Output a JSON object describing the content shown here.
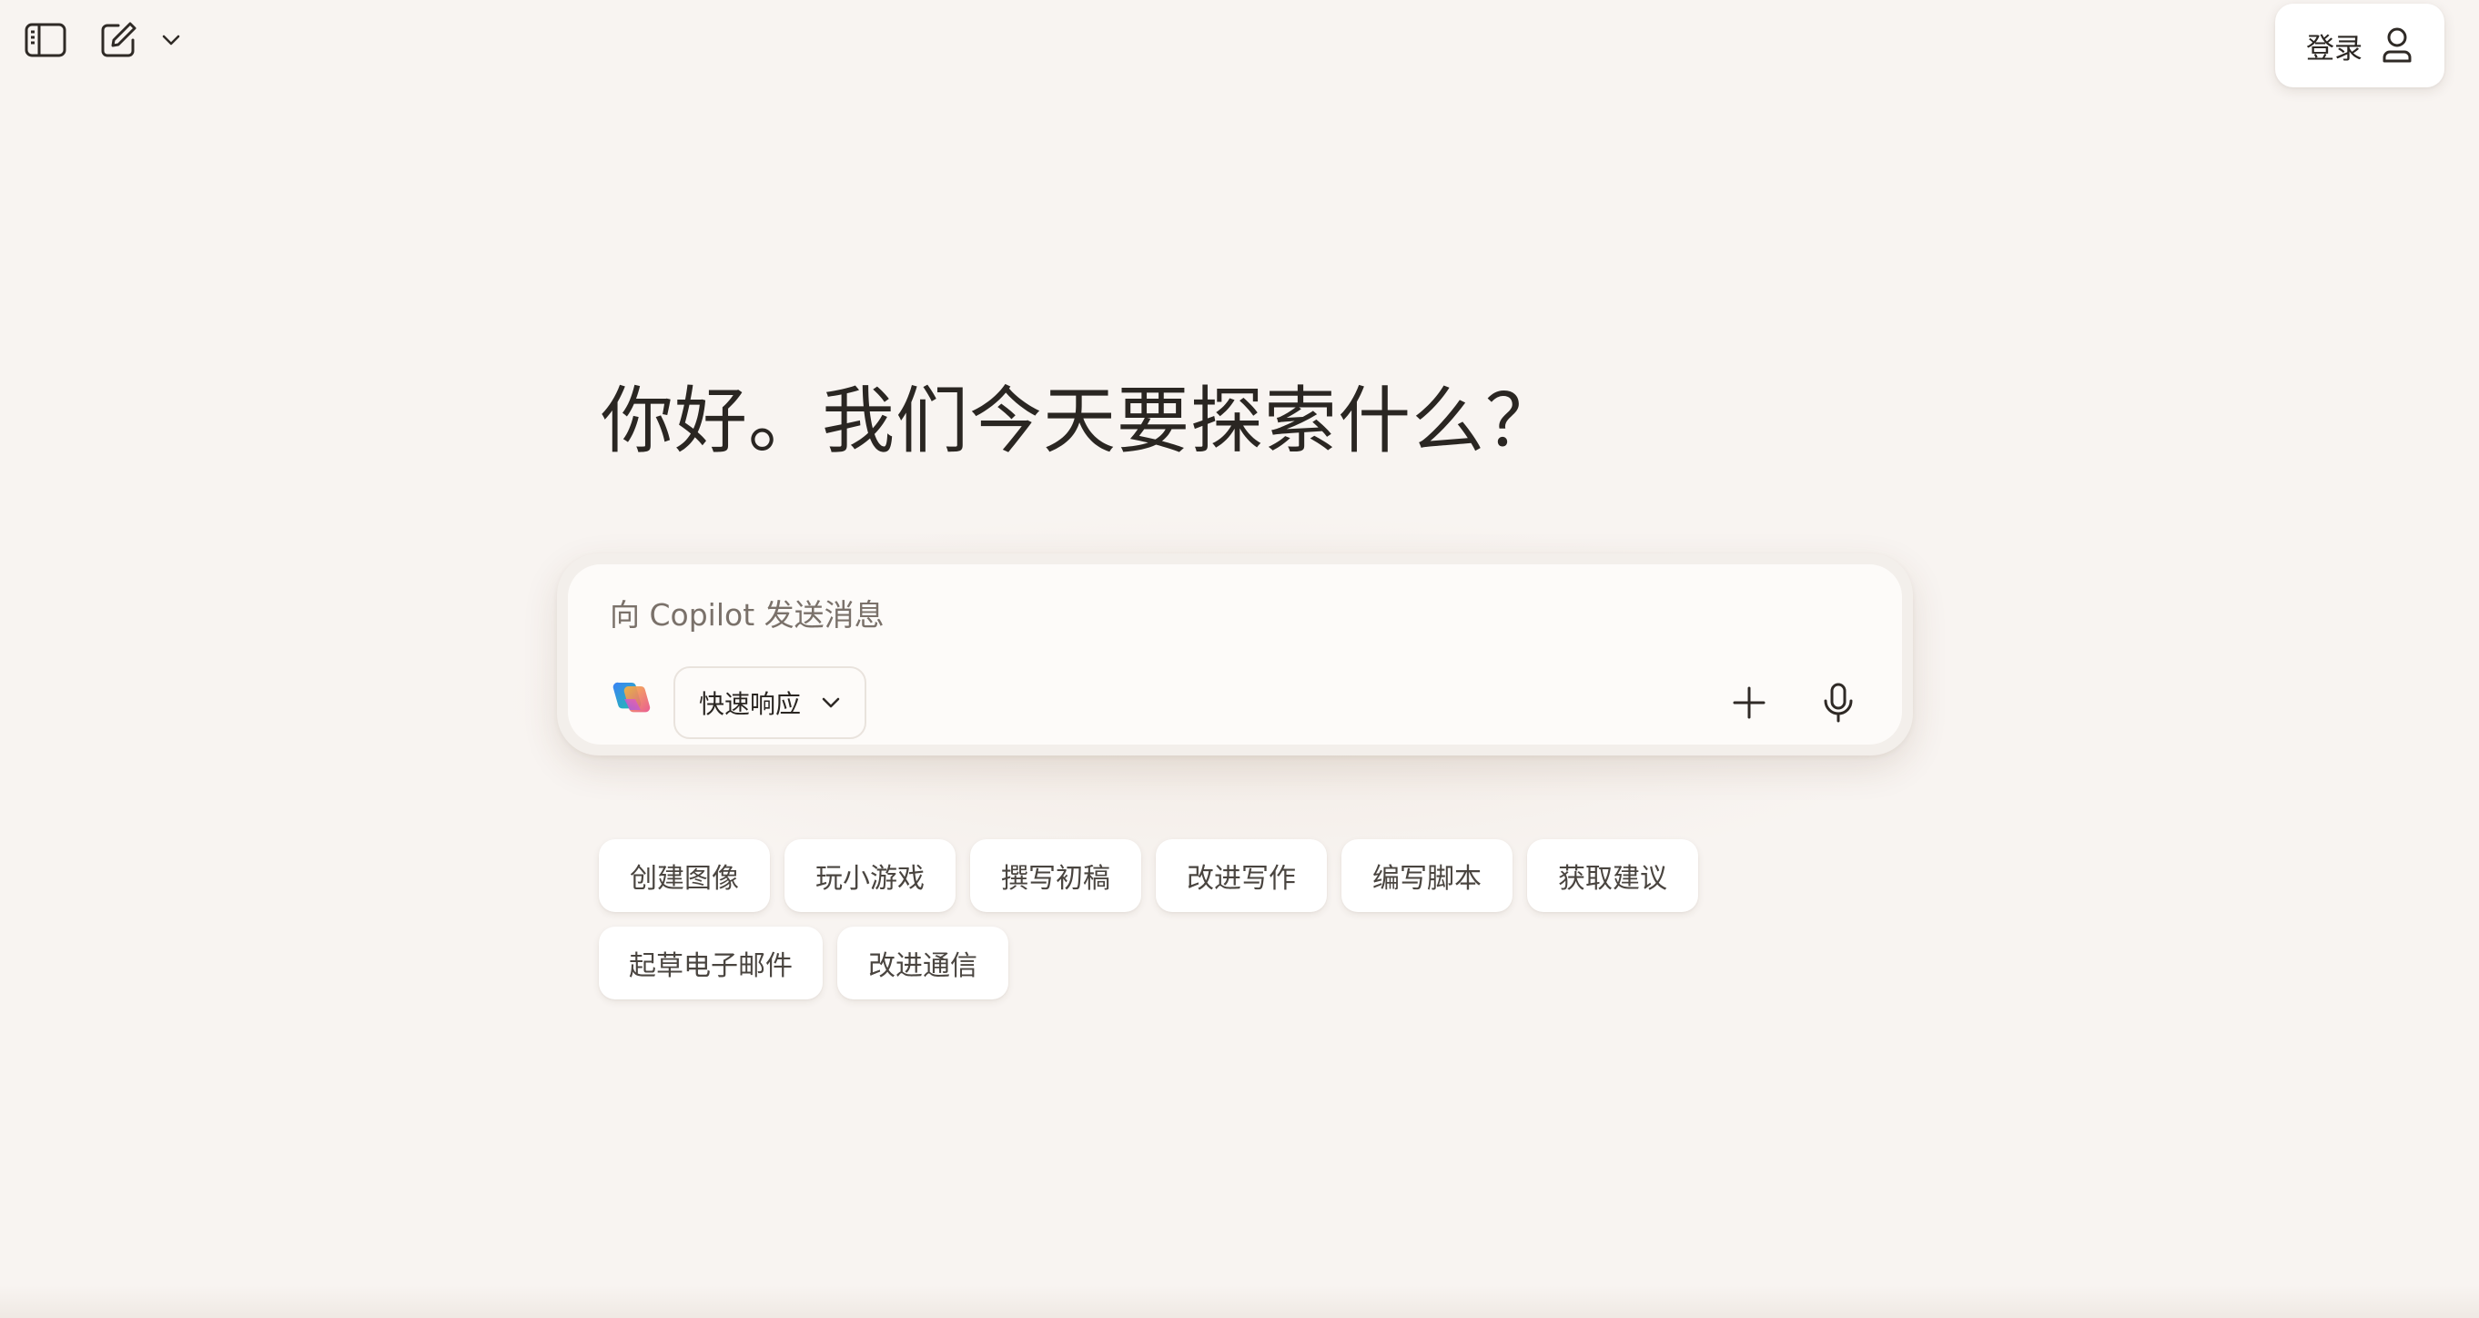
{
  "header": {
    "login_label": "登录",
    "icons": [
      "sidebar-icon",
      "new-chat-icon",
      "chevron-down-icon",
      "user-icon"
    ]
  },
  "main": {
    "headline": "你好。我们今天要探索什么？"
  },
  "composer": {
    "placeholder": "向 Copilot 发送消息",
    "value": "",
    "mode_label": "快速响应",
    "icons": [
      "copilot-logo-icon",
      "chevron-down-icon",
      "plus-icon",
      "microphone-icon"
    ]
  },
  "suggestions": [
    "创建图像",
    "玩小游戏",
    "撰写初稿",
    "改进写作",
    "编写脚本",
    "获取建议",
    "起草电子邮件",
    "改进通信"
  ],
  "colors": {
    "background": "#f8f4f1",
    "surface": "#ffffff",
    "text_primary": "#2a2622",
    "text_muted": "#7a716a"
  }
}
